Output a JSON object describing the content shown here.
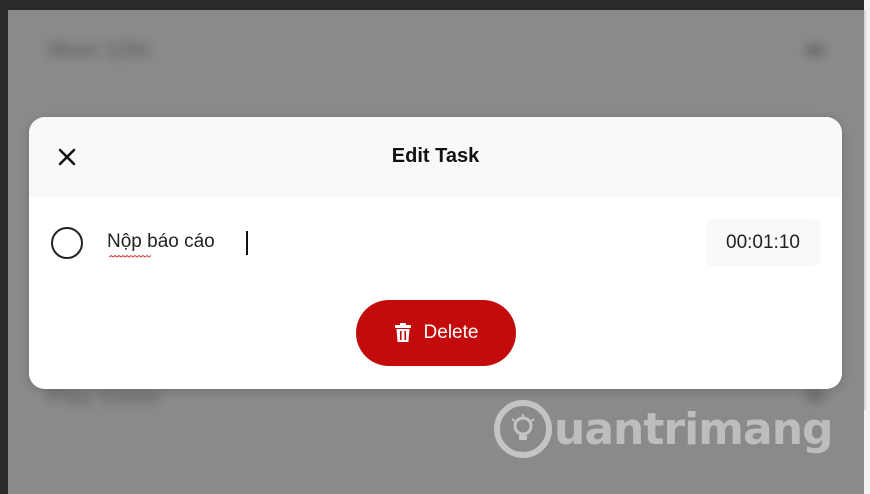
{
  "background": {
    "blurred_row_1": "Meet 12th",
    "blurred_row_2": "Play Game"
  },
  "modal": {
    "title": "Edit Task",
    "close_icon": "close-icon",
    "task": {
      "text": "Nộp báo cáo",
      "completed": false,
      "timer": "00:01:10"
    },
    "delete": {
      "label": "Delete",
      "icon": "trash-icon",
      "color": "#c40b0b"
    }
  },
  "watermark": {
    "text": "uantrimang",
    "logo": "lightbulb-logo"
  }
}
